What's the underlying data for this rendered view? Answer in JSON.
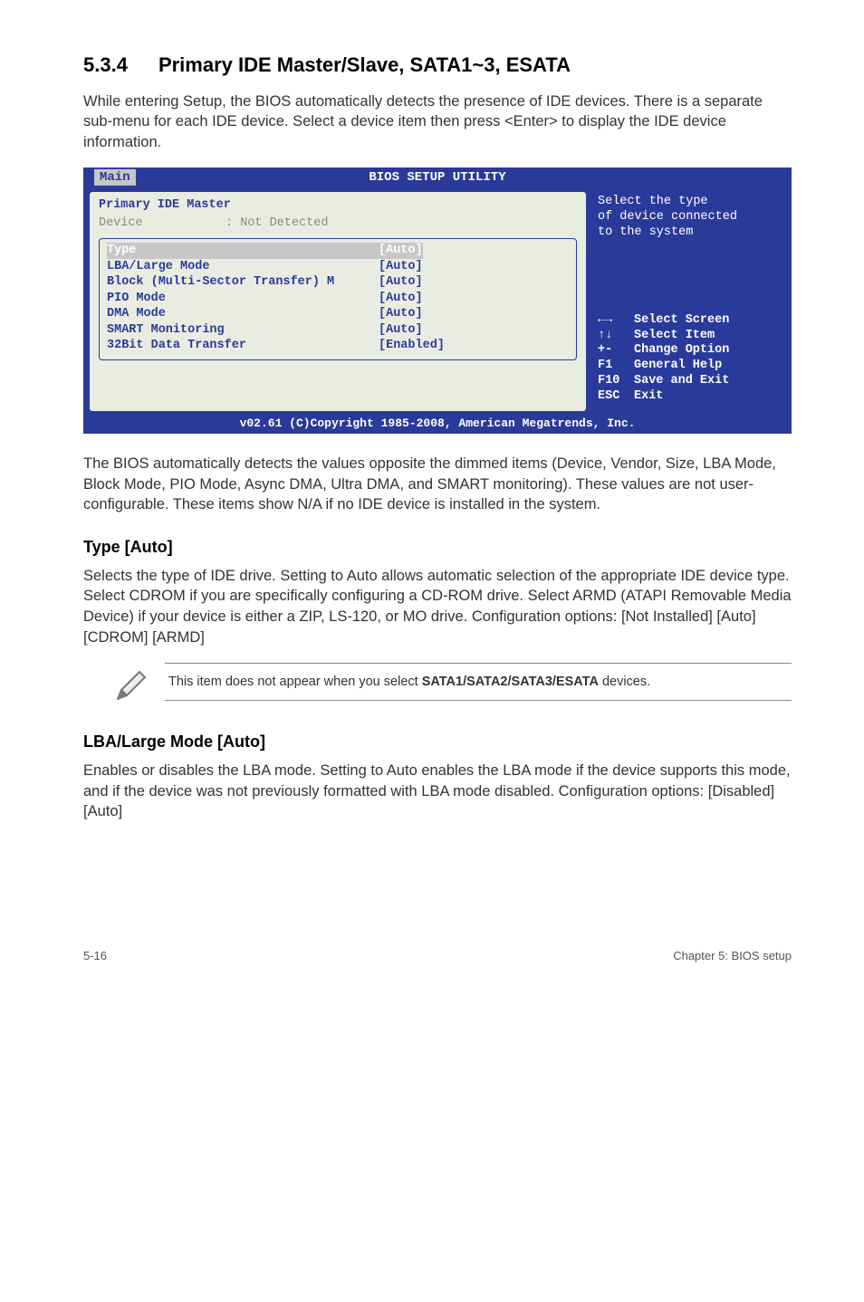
{
  "section": {
    "number": "5.3.4",
    "title": "Primary IDE Master/Slave, SATA1~3, ESATA"
  },
  "intro": "While entering Setup, the BIOS automatically detects the presence of IDE devices. There is a separate sub-menu for each IDE device. Select a device item then press <Enter> to display the IDE device information.",
  "bios": {
    "titlebar": "BIOS SETUP UTILITY",
    "tab": "Main",
    "left_header": "Primary IDE Master",
    "device_label": "Device",
    "device_value": ": Not Detected",
    "rows": [
      {
        "label": "Type",
        "value": "[Auto]",
        "selected": true
      },
      {
        "label": "LBA/Large Mode",
        "value": "[Auto]",
        "selected": false
      },
      {
        "label": "Block (Multi-Sector Transfer) M",
        "value": "[Auto]",
        "selected": false
      },
      {
        "label": "PIO Mode",
        "value": "[Auto]",
        "selected": false
      },
      {
        "label": "DMA Mode",
        "value": "[Auto]",
        "selected": false
      },
      {
        "label": "SMART Monitoring",
        "value": "[Auto]",
        "selected": false
      },
      {
        "label": "32Bit Data Transfer",
        "value": "[Enabled]",
        "selected": false
      }
    ],
    "hint_line1": "Select the type",
    "hint_line2": "of device connected",
    "hint_line3": "to the system",
    "keys": [
      {
        "k": "←→",
        "d": "Select Screen"
      },
      {
        "k": "↑↓",
        "d": "Select Item"
      },
      {
        "k": "+-",
        "d": "Change Option"
      },
      {
        "k": "F1",
        "d": "General Help"
      },
      {
        "k": "F10",
        "d": "Save and Exit"
      },
      {
        "k": "ESC",
        "d": "Exit"
      }
    ],
    "footer": "v02.61 (C)Copyright 1985-2008, American Megatrends, Inc."
  },
  "post_bios": "The BIOS automatically detects the values opposite the dimmed items (Device, Vendor, Size, LBA Mode, Block Mode, PIO Mode, Async DMA, Ultra DMA, and SMART monitoring). These values are not user-configurable. These items show N/A if no IDE device is installed in the system.",
  "type_heading": "Type [Auto]",
  "type_body": "Selects the type of IDE drive. Setting to Auto allows automatic selection of the appropriate IDE device type. Select CDROM if you are specifically configuring a CD-ROM drive. Select ARMD (ATAPI Removable Media Device) if your device is either a ZIP, LS-120, or MO drive. Configuration options: [Not Installed] [Auto] [CDROM] [ARMD]",
  "note_prefix": "This item does not appear when you select ",
  "note_bold": "SATA1/SATA2/SATA3/ESATA",
  "note_suffix": " devices.",
  "lba_heading": "LBA/Large Mode [Auto]",
  "lba_body": "Enables or disables the LBA mode. Setting to Auto enables the LBA mode if the device supports this mode, and if the device was not previously formatted with LBA mode disabled. Configuration options: [Disabled] [Auto]",
  "footer_left": "5-16",
  "footer_right": "Chapter 5: BIOS setup"
}
